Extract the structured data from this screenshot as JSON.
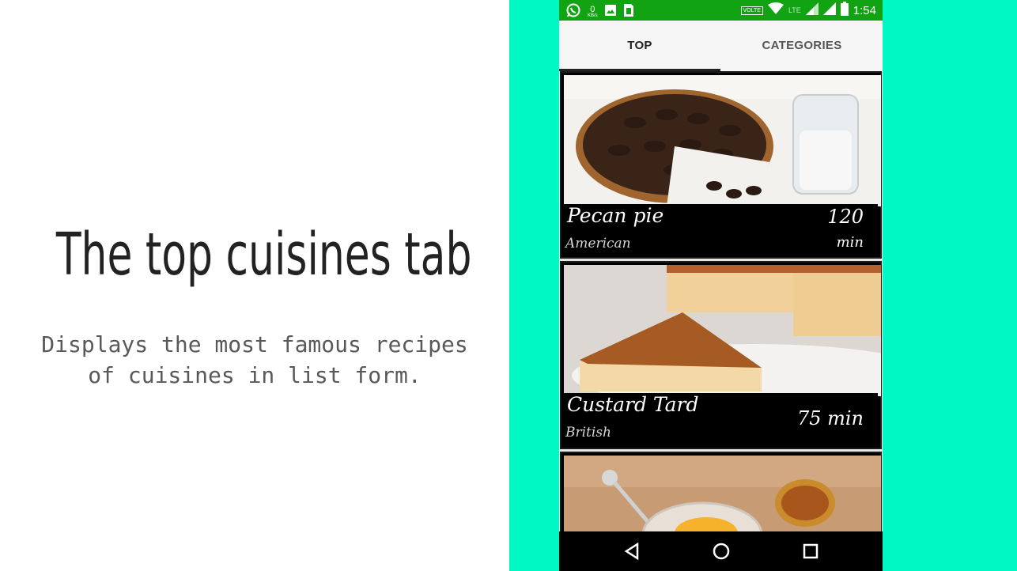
{
  "slide": {
    "title": "The top cuisines tab",
    "description": "Displays the most famous recipes of cuisines in list form."
  },
  "status_bar": {
    "data_rate_value": "0",
    "data_rate_unit": "KB/s",
    "volte": "VOLTE",
    "lte": "LTE",
    "time": "1:54"
  },
  "tabs": [
    {
      "label": "TOP",
      "selected": true
    },
    {
      "label": "CATEGORIES",
      "selected": false
    }
  ],
  "recipes": [
    {
      "name": "Pecan pie",
      "cuisine": "American",
      "time_value": "120",
      "time_unit": "min"
    },
    {
      "name": "Custard Tard",
      "cuisine": "British",
      "time": "75 min"
    }
  ],
  "nav": {
    "back": "back-icon",
    "home": "home-icon",
    "recents": "recents-icon"
  },
  "colors": {
    "slide_background_right": "#00f8c5",
    "status_bar": "#12a312",
    "tab_bar": "#f5f5f5",
    "tab_indicator": "#222222"
  }
}
